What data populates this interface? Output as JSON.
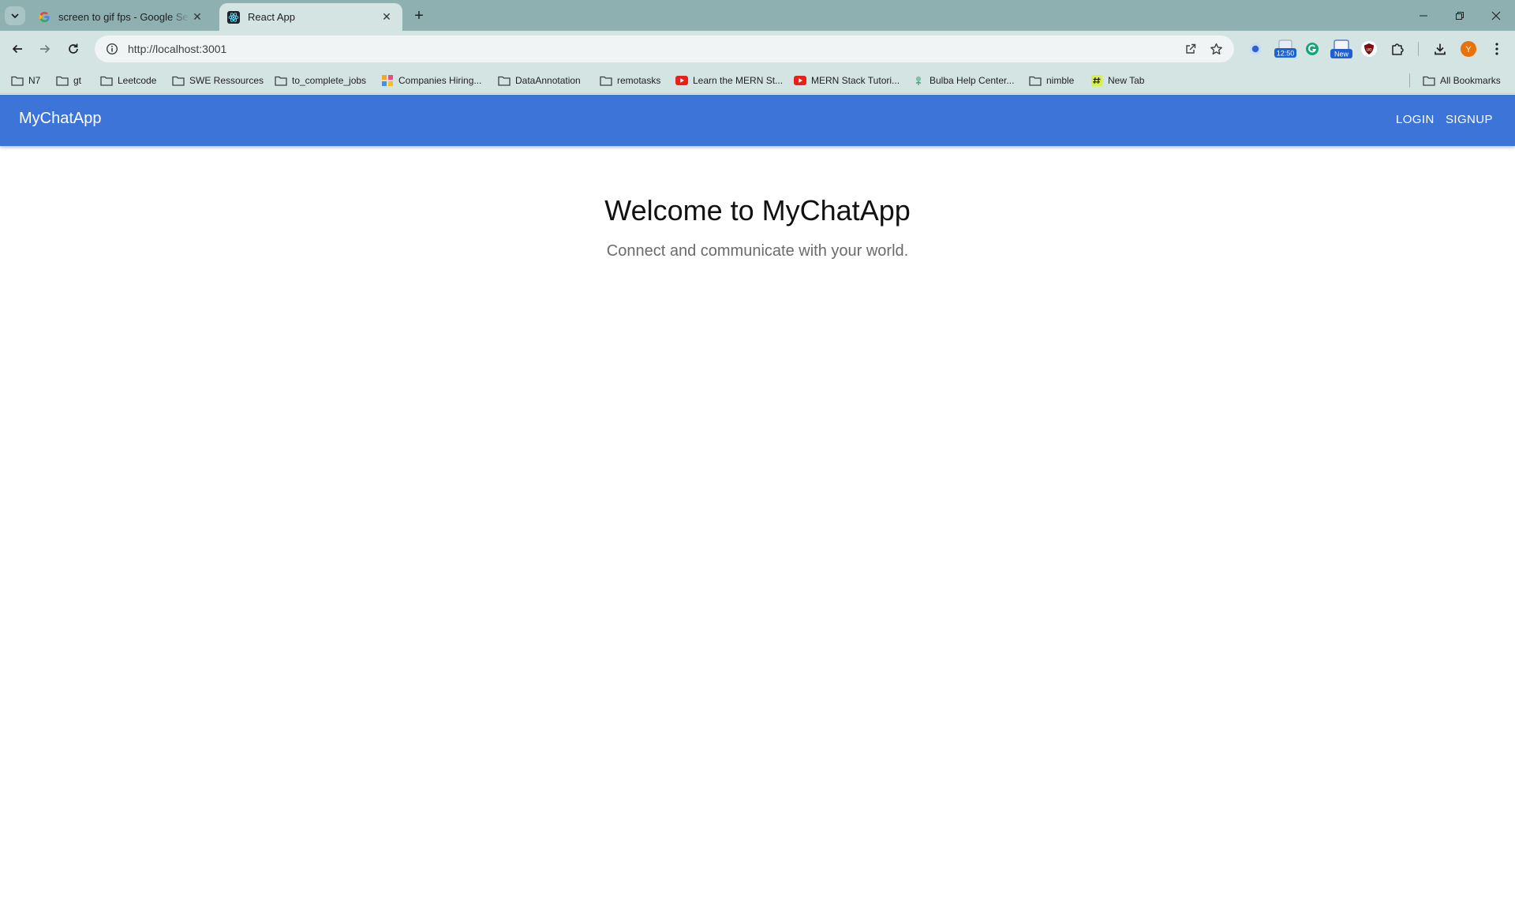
{
  "browser": {
    "tabs": [
      {
        "title": "screen to gif fps - Google Search",
        "favicon": "google-g-icon",
        "active": false
      },
      {
        "title": "React App",
        "favicon": "react-icon",
        "active": true
      }
    ],
    "address": {
      "url": "http://localhost:3001"
    },
    "extensions": [
      {
        "name": "record-extension-icon"
      },
      {
        "name": "calendar-extension-icon",
        "badge": "12:50"
      },
      {
        "name": "grammarly-icon"
      },
      {
        "name": "new-extension-icon",
        "badge": "New"
      },
      {
        "name": "ublock-icon"
      },
      {
        "name": "puzzle-icon"
      }
    ],
    "profile_initial": "Y",
    "bookmarks": [
      {
        "label": "N7",
        "icon": "folder-icon"
      },
      {
        "label": "gt",
        "icon": "folder-icon"
      },
      {
        "label": "Leetcode",
        "icon": "folder-icon"
      },
      {
        "label": "SWE Ressources",
        "icon": "folder-icon"
      },
      {
        "label": "to_complete_jobs",
        "icon": "folder-icon"
      },
      {
        "label": "Companies Hiring...",
        "icon": "colored-grid-icon"
      },
      {
        "label": "DataAnnotation",
        "icon": "folder-icon"
      },
      {
        "label": "remotasks",
        "icon": "folder-icon"
      },
      {
        "label": "Learn the MERN St...",
        "icon": "youtube-icon"
      },
      {
        "label": "MERN Stack Tutori...",
        "icon": "youtube-icon"
      },
      {
        "label": "Bulba Help Center...",
        "icon": "leaf-icon"
      },
      {
        "label": "nimble",
        "icon": "folder-icon"
      },
      {
        "label": "New Tab",
        "icon": "hash-icon"
      }
    ],
    "all_bookmarks": "All Bookmarks"
  },
  "app": {
    "brand": "MyChatApp",
    "nav": {
      "login": "LOGIN",
      "signup": "SIGNUP"
    },
    "hero": {
      "title": "Welcome to MyChatApp",
      "subtitle": "Connect and communicate with your world."
    },
    "colors": {
      "appbar": "#3d74d7",
      "browser_frame": "#8fb0b0",
      "toolbar": "#d4e4e3"
    }
  }
}
